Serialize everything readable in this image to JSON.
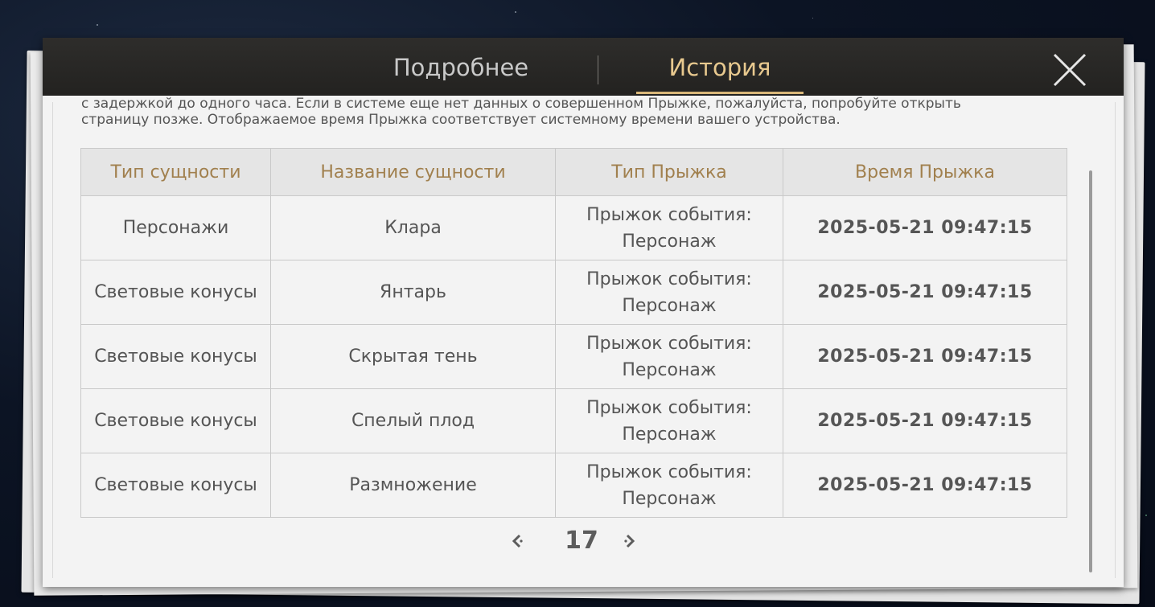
{
  "tabs": [
    {
      "label": "Подробнее",
      "active": false
    },
    {
      "label": "История",
      "active": true
    }
  ],
  "notice": {
    "line1": "с задержкой до одного часа. Если в системе еще нет данных о совершенном Прыжке, пожалуйста, попробуйте открыть",
    "line2": "страницу позже. Отображаемое время Прыжка соответствует системному времени вашего устройства."
  },
  "table": {
    "headers": [
      "Тип сущности",
      "Название сущности",
      "Тип Прыжка",
      "Время Прыжка"
    ],
    "rows": [
      {
        "type": "Персонажи",
        "name": "Клара",
        "jump_type": "Прыжок события: Персонаж",
        "time": "2025-05-21 09:47:15",
        "highlight": true
      },
      {
        "type": "Световые конусы",
        "name": "Янтарь",
        "jump_type": "Прыжок события: Персонаж",
        "time": "2025-05-21 09:47:15",
        "highlight": false
      },
      {
        "type": "Световые конусы",
        "name": "Скрытая тень",
        "jump_type": "Прыжок события: Персонаж",
        "time": "2025-05-21 09:47:15",
        "highlight": false
      },
      {
        "type": "Световые конусы",
        "name": "Спелый плод",
        "jump_type": "Прыжок события: Персонаж",
        "time": "2025-05-21 09:47:15",
        "highlight": false
      },
      {
        "type": "Световые конусы",
        "name": "Размножение",
        "jump_type": "Прыжок события: Персонаж",
        "time": "2025-05-21 09:47:15",
        "highlight": false
      }
    ]
  },
  "pager": {
    "page": "17"
  },
  "colors": {
    "header_text": "#a1804e",
    "highlight": "#d9a45b",
    "active_tab": "#e8c98f"
  },
  "icons": {
    "close": "close-icon",
    "prev": "chevron-left-icon",
    "next": "chevron-right-icon"
  }
}
